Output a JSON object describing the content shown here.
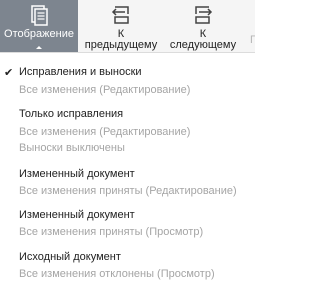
{
  "toolbar": {
    "display": {
      "label": "Отображение"
    },
    "prev": {
      "line1": "К",
      "line2": "предыдущему"
    },
    "next": {
      "line1": "К",
      "line2": "следующему"
    },
    "partial": {
      "label": "Пр"
    }
  },
  "menu": {
    "items": [
      {
        "title": "Исправления и выноски",
        "sub": [
          "Все изменения (Редактирование)"
        ],
        "checked": true
      },
      {
        "title": "Только исправления",
        "sub": [
          "Все изменения (Редактирование)",
          "Выноски выключены"
        ],
        "checked": false
      },
      {
        "title": "Измененный документ",
        "sub": [
          "Все изменения приняты (Редактирование)"
        ],
        "checked": false
      },
      {
        "title": "Измененный документ",
        "sub": [
          "Все изменения приняты (Просмотр)"
        ],
        "checked": false
      },
      {
        "title": "Исходный документ",
        "sub": [
          "Все изменения отклонены (Просмотр)"
        ],
        "checked": false
      }
    ],
    "check_glyph": "✔"
  }
}
